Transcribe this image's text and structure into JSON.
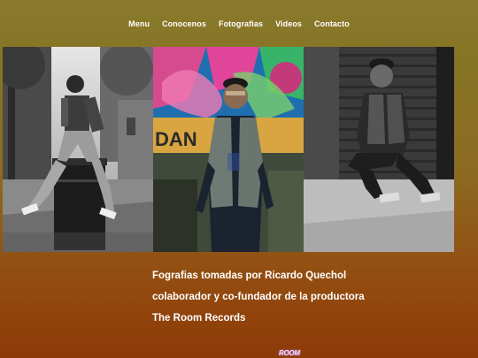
{
  "nav": {
    "items": [
      {
        "label": "Menu"
      },
      {
        "label": "Conocenos"
      },
      {
        "label": "Fotografias"
      },
      {
        "label": "Videos"
      },
      {
        "label": "Contacto"
      }
    ]
  },
  "gallery": {
    "photos": [
      {
        "subject": "man sitting on bin, street"
      },
      {
        "subject": "man in denim vest, mural wall"
      },
      {
        "subject": "man crouching, shutter"
      }
    ]
  },
  "caption": {
    "line1": "Fografias tomadas por Ricardo Quechol",
    "line2": "colaborador y co-fundador de la productora",
    "line3": "The Room Records"
  },
  "footer": {
    "logo_text": "ROOM"
  },
  "colors": {
    "background_top": "#8a7a2c",
    "background_bottom": "#8d3a06",
    "text": "#ffffff"
  }
}
